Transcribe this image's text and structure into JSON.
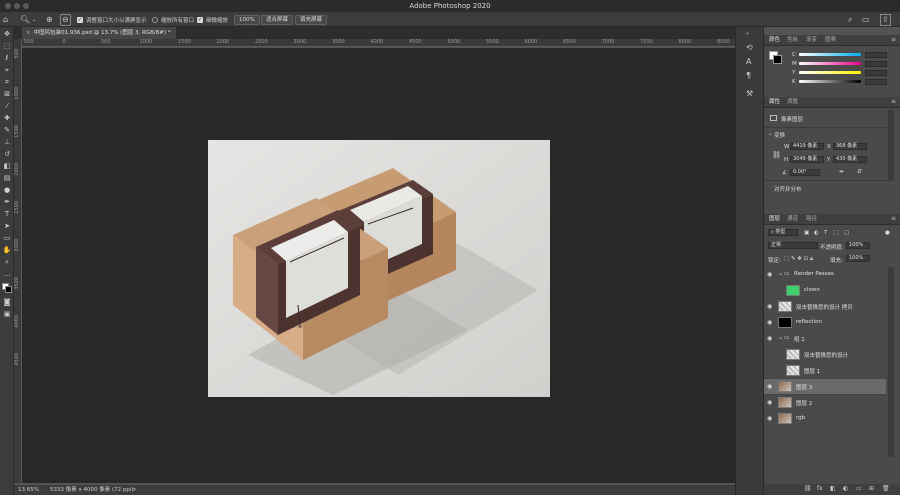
{
  "app": {
    "title": "Adobe Photoshop 2020"
  },
  "options_bar": {
    "resize_windows": "调整窗口大小以满屏显示",
    "zoom_all": "缩放所有窗口",
    "scrubby_zoom": "细微缩放",
    "zoom_100": "100%",
    "fit_screen": "适合屏幕",
    "fill_screen": "填充屏幕"
  },
  "document": {
    "tab_title": "中国风包装01.936.psd @ 13.7% (图层 3, RGB/8#) *",
    "close": "×"
  },
  "rulers": {
    "h": [
      "500",
      "0",
      "500",
      "1000",
      "1500",
      "2000",
      "2500",
      "3000",
      "3500",
      "4000",
      "4500",
      "5000",
      "5500",
      "6000",
      "6500",
      "7000",
      "7500",
      "8000",
      "8500"
    ],
    "v": [
      "500",
      "1000",
      "1500",
      "2000",
      "2500",
      "3000",
      "3500",
      "4000",
      "4500"
    ]
  },
  "status": {
    "zoom": "13.65%",
    "info": "5333 像素 x 4000 像素 (72 ppi)",
    "arrow": ">"
  },
  "color_panel": {
    "tabs": [
      "颜色",
      "色板",
      "渐变",
      "图案"
    ],
    "channels": [
      {
        "label": "C",
        "gradient": [
          "#ffffff",
          "#00aeef"
        ]
      },
      {
        "label": "M",
        "gradient": [
          "#ffffff",
          "#ec008c"
        ]
      },
      {
        "label": "Y",
        "gradient": [
          "#ffffff",
          "#fff200"
        ]
      },
      {
        "label": "K",
        "gradient": [
          "#ffffff",
          "#000000"
        ]
      }
    ]
  },
  "properties_panel": {
    "tabs": [
      "属性",
      "调整"
    ],
    "kind": "像素图层",
    "transform_heading": "变换",
    "w_label": "W",
    "w_value": "4419 像素",
    "x_label": "X",
    "x_value": "368 像素",
    "h_label": "H",
    "h_value": "3049 像素",
    "y_label": "Y",
    "y_value": "430 像素",
    "angle": "0.00°",
    "align_heading": "对齐并分布"
  },
  "layers_panel": {
    "tabs": [
      "图层",
      "通道",
      "路径"
    ],
    "filter_label": "类型",
    "blend_mode": "正常",
    "opacity_label": "不透明度:",
    "opacity_value": "100%",
    "lock_label": "锁定:",
    "fill_label": "填充:",
    "fill_value": "100%",
    "layers": [
      {
        "name": "Render Passes",
        "kind": "group",
        "visible": true,
        "indent": 0,
        "selected": false,
        "thumb": "folder"
      },
      {
        "name": "clown",
        "kind": "layer",
        "visible": false,
        "indent": 1,
        "selected": false,
        "thumb": "green"
      },
      {
        "name": "双击替换您的设计 拷贝",
        "kind": "layer",
        "visible": true,
        "indent": 0,
        "selected": false,
        "thumb": "smart"
      },
      {
        "name": "reflection",
        "kind": "layer",
        "visible": true,
        "indent": 0,
        "selected": false,
        "thumb": "black"
      },
      {
        "name": "组 1",
        "kind": "group",
        "visible": true,
        "indent": 0,
        "selected": false,
        "thumb": "folder"
      },
      {
        "name": "双击替换您的设计",
        "kind": "layer",
        "visible": false,
        "indent": 1,
        "selected": false,
        "thumb": "smart"
      },
      {
        "name": "图层 1",
        "kind": "layer",
        "visible": false,
        "indent": 1,
        "selected": false,
        "thumb": "smart"
      },
      {
        "name": "图层 3",
        "kind": "layer",
        "visible": true,
        "indent": 0,
        "selected": true,
        "thumb": "photo"
      },
      {
        "name": "图层 2",
        "kind": "layer",
        "visible": true,
        "indent": 0,
        "selected": false,
        "thumb": "photo"
      },
      {
        "name": "rgb",
        "kind": "layer",
        "visible": true,
        "indent": 0,
        "selected": false,
        "thumb": "photo"
      }
    ],
    "footer_icons": [
      "link-icon",
      "fx-icon",
      "mask-icon",
      "adjustment-icon",
      "new-group-icon",
      "new-layer-icon",
      "trash-icon"
    ]
  },
  "colors": {
    "accent_selected_layer": "#6a6a6a",
    "box_kraft": "#c9a07a",
    "box_band": "#5b3e3a",
    "box_label": "#e9e9e6"
  }
}
